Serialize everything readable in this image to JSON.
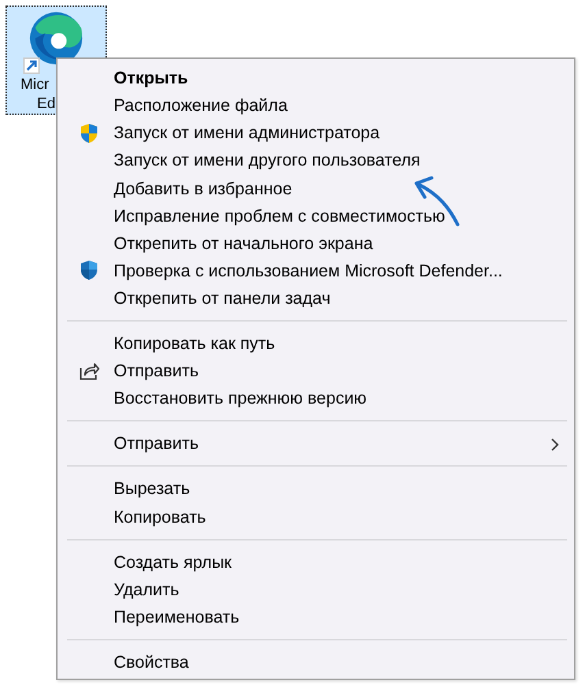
{
  "desktop_icon": {
    "label_lines": [
      "Micr",
      "Ed"
    ],
    "selected": true
  },
  "context_menu": {
    "sections": [
      {
        "items": [
          {
            "label": "Открыть",
            "default": true,
            "kind": "plain"
          },
          {
            "label": "Расположение файла",
            "default": false,
            "kind": "plain"
          },
          {
            "label": "Запуск от имени администратора",
            "default": false,
            "kind": "uac-shield"
          },
          {
            "label": "Запуск от имени другого пользователя",
            "default": false,
            "kind": "plain"
          },
          {
            "label": "Добавить в избранное",
            "default": false,
            "kind": "plain"
          },
          {
            "label": "Исправление проблем с совместимостью",
            "default": false,
            "kind": "plain"
          },
          {
            "label": "Открепить от начального экрана",
            "default": false,
            "kind": "plain"
          },
          {
            "label": "Проверка с использованием Microsoft Defender...",
            "default": false,
            "kind": "defender-shield"
          },
          {
            "label": "Открепить от панели задач",
            "default": false,
            "kind": "plain"
          }
        ]
      },
      {
        "items": [
          {
            "label": "Копировать как путь",
            "default": false,
            "kind": "plain"
          },
          {
            "label": "Отправить",
            "default": false,
            "kind": "share"
          },
          {
            "label": "Восстановить прежнюю версию",
            "default": false,
            "kind": "plain"
          }
        ]
      },
      {
        "items": [
          {
            "label": "Отправить",
            "default": false,
            "kind": "submenu"
          }
        ]
      },
      {
        "items": [
          {
            "label": "Вырезать",
            "default": false,
            "kind": "plain"
          },
          {
            "label": "Копировать",
            "default": false,
            "kind": "plain"
          }
        ]
      },
      {
        "items": [
          {
            "label": "Создать ярлык",
            "default": false,
            "kind": "plain"
          },
          {
            "label": "Удалить",
            "default": false,
            "kind": "plain"
          },
          {
            "label": "Переименовать",
            "default": false,
            "kind": "plain"
          }
        ]
      },
      {
        "items": [
          {
            "label": "Свойства",
            "default": false,
            "kind": "plain"
          }
        ]
      }
    ]
  }
}
